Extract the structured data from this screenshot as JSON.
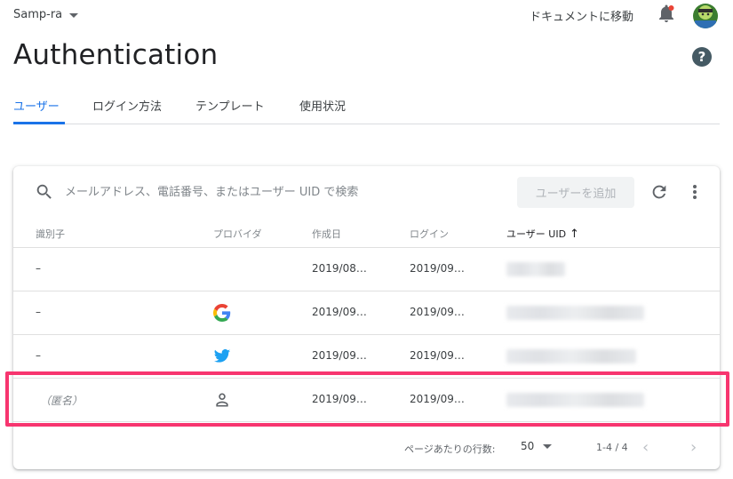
{
  "header": {
    "project_name": "Samp-ra",
    "docs_link": "ドキュメントに移動"
  },
  "page": {
    "title": "Authentication",
    "help_glyph": "?"
  },
  "tabs": [
    {
      "label": "ユーザー",
      "active": true
    },
    {
      "label": "ログイン方法",
      "active": false
    },
    {
      "label": "テンプレート",
      "active": false
    },
    {
      "label": "使用状況",
      "active": false
    }
  ],
  "toolbar": {
    "search_placeholder": "メールアドレス、電話番号、またはユーザー UID で検索",
    "add_user_label": "ユーザーを追加"
  },
  "table": {
    "columns": [
      "識別子",
      "プロバイダ",
      "作成日",
      "ログイン",
      "ユーザー UID"
    ],
    "sort_glyph": "↑",
    "rows": [
      {
        "identifier": "–",
        "provider_icon": "none",
        "created": "2019/08…",
        "signed_in": "2019/09…"
      },
      {
        "identifier": "–",
        "provider_icon": "google-icon",
        "created": "2019/09…",
        "signed_in": "2019/09…"
      },
      {
        "identifier": "–",
        "provider_icon": "twitter-icon",
        "created": "2019/09…",
        "signed_in": "2019/09…"
      },
      {
        "identifier": "（匿名）",
        "provider_icon": "person-icon",
        "created": "2019/09…",
        "signed_in": "2019/09…"
      }
    ]
  },
  "pagination": {
    "rows_per_page_label": "ページあたりの行数:",
    "rows_per_page_value": "50",
    "range": "1-4 / 4",
    "prev_glyph": "‹",
    "next_glyph": "›"
  },
  "colors": {
    "accent": "#1a73e8",
    "highlight": "#f7356f"
  }
}
